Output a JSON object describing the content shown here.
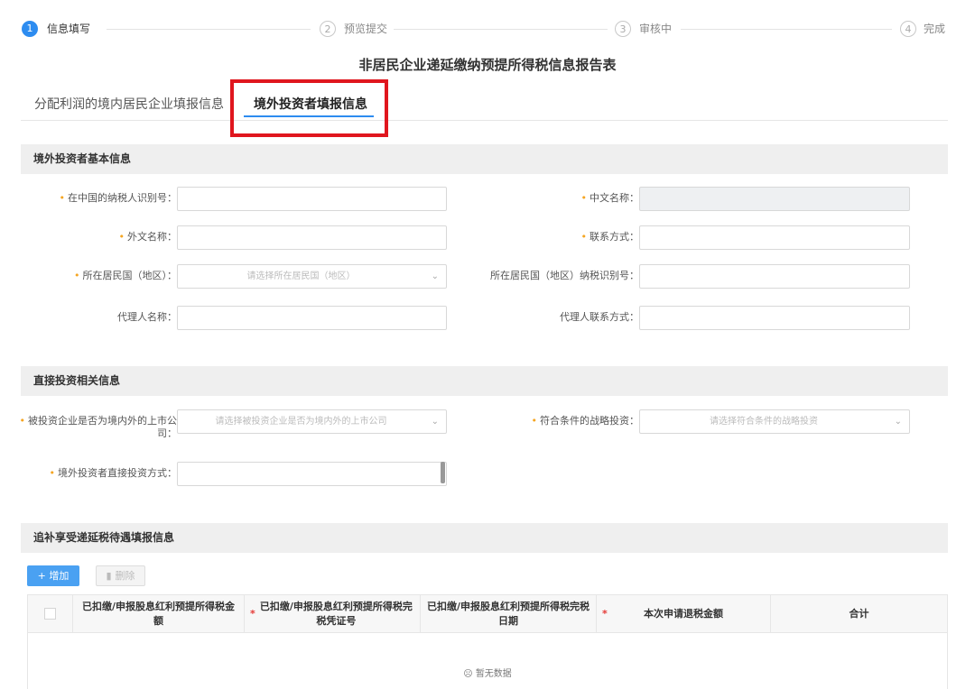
{
  "steps": [
    {
      "num": "1",
      "label": "信息填写"
    },
    {
      "num": "2",
      "label": "预览提交"
    },
    {
      "num": "3",
      "label": "审核中"
    },
    {
      "num": "4",
      "label": "完成"
    }
  ],
  "page_title": "非居民企业递延缴纳预提所得税信息报告表",
  "tabs": [
    {
      "label": "分配利润的境内居民企业填报信息",
      "active": false
    },
    {
      "label": "境外投资者填报信息",
      "active": true
    }
  ],
  "sections": {
    "basic": {
      "title": "境外投资者基本信息",
      "fields": {
        "tax_id": {
          "label": "在中国的纳税人识别号：",
          "required": true,
          "value": ""
        },
        "cn_name": {
          "label": "中文名称：",
          "required": true,
          "value": ""
        },
        "foreign_name": {
          "label": "外文名称：",
          "required": true,
          "value": ""
        },
        "contact": {
          "label": "联系方式：",
          "required": true,
          "value": ""
        },
        "residence": {
          "label": "所在居民国（地区）：",
          "required": true,
          "placeholder": "请选择所在居民国（地区）"
        },
        "residence_tax_id": {
          "label": "所在居民国（地区）纳税识别号：",
          "required": false,
          "value": ""
        },
        "agent_name": {
          "label": "代理人名称：",
          "required": false,
          "value": ""
        },
        "agent_contact": {
          "label": "代理人联系方式：",
          "required": false,
          "value": ""
        }
      }
    },
    "direct": {
      "title": "直接投资相关信息",
      "fields": {
        "listed_line1": "被投资企业是否为境内外的上市公",
        "listed_line2": "司：",
        "listed_placeholder": "请选择被投资企业是否为境内外的上市公司",
        "strategic_label": "符合条件的战略投资：",
        "strategic_placeholder": "请选择符合条件的战略投资",
        "method_label": "境外投资者直接投资方式："
      }
    },
    "supplement": {
      "title": "追补享受递延税待遇填报信息",
      "add_button": "+ 增加",
      "delete_button": "删除",
      "columns": [
        "已扣缴/申报股息红利预提所得税金额",
        "已扣缴/申报股息红利预提所得税完税凭证号",
        "已扣缴/申报股息红利预提所得税完税日期",
        "本次申请退税金额",
        "合计"
      ],
      "empty_text": "暂无数据"
    }
  },
  "colors": {
    "accent": "#2d8cf0",
    "highlight": "#e0161e",
    "required": "#f5a623"
  }
}
